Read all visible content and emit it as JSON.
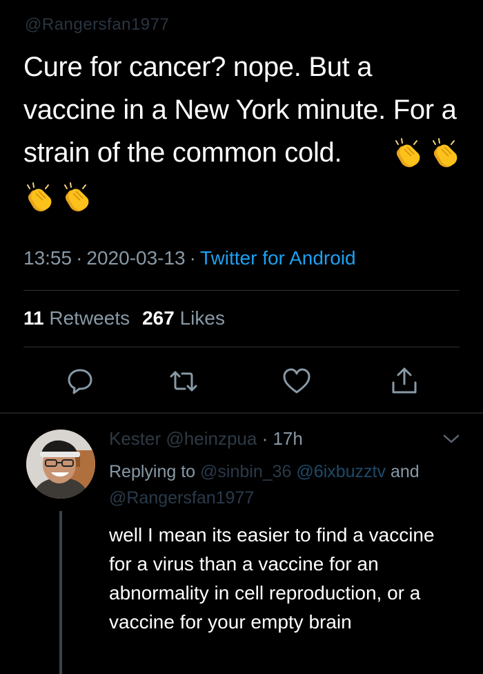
{
  "tweet": {
    "handle": "@Rangersfan1977",
    "text": "Cure for cancer? nope. But a vaccine in a New York minute. For a strain of the common cold.",
    "time": "13:55",
    "date": "2020-03-13",
    "separator": "·",
    "client": "Twitter for Android",
    "retweets_count": "11",
    "retweets_label": "Retweets",
    "likes_count": "267",
    "likes_label": "Likes",
    "emoji_name": "clapping-hands"
  },
  "reply": {
    "name": "Kester",
    "handle": "@heinzpua",
    "separator": "·",
    "age": "17h",
    "replying_prefix": "Replying to",
    "mention_1": "@sinbin_36",
    "mention_2": "@6ixbuzztv",
    "and_word": "and",
    "mention_3": "@Rangersfan1977",
    "text": "well I mean its easier to find a vaccine for a virus than a vaccine for an abnormality in cell reproduction, or a vaccine for your empty brain"
  },
  "icons": {
    "reply": "comment-icon",
    "retweet": "retweet-icon",
    "like": "heart-icon",
    "share": "share-icon",
    "more": "chevron-down-icon"
  },
  "colors": {
    "background": "#000000",
    "text_primary": "#ffffff",
    "text_secondary": "#8899a6",
    "accent": "#1da1f2",
    "divider": "#2f3336"
  }
}
